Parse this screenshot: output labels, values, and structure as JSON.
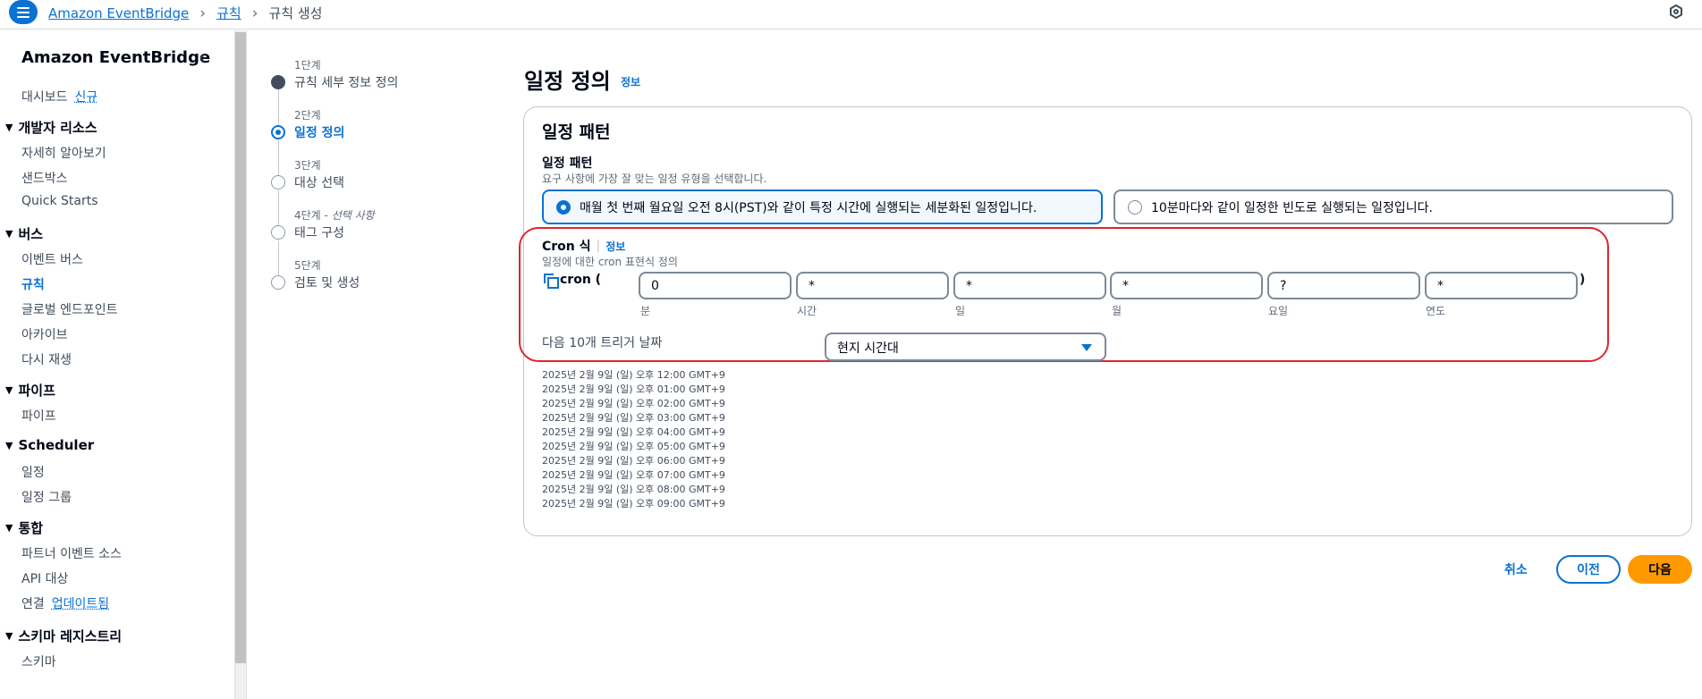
{
  "header": {
    "breadcrumbs": [
      "Amazon EventBridge",
      "규칙",
      "규칙 생성"
    ],
    "menu_icon": "hamburger-menu-icon",
    "settings_icon": "hexagon-gear-icon"
  },
  "sidebar": {
    "title": "Amazon EventBridge",
    "close_icon": "chevron-left-icon",
    "dashboard": {
      "label": "대시보드",
      "badge": "신규"
    },
    "sections": [
      {
        "title": "개발자 리소스",
        "items": [
          "자세히 알아보기",
          "샌드박스",
          "Quick Starts"
        ]
      },
      {
        "title": "버스",
        "items": [
          "이벤트 버스",
          "규칙",
          "글로벌 엔드포인트",
          "아카이브",
          "다시 재생"
        ]
      },
      {
        "title": "파이프",
        "items": [
          "파이프"
        ]
      },
      {
        "title": "Scheduler",
        "items": [
          "일정",
          "일정 그룹"
        ]
      },
      {
        "title": "통합",
        "items": [
          "파트너 이벤트 소스",
          "API 대상"
        ]
      },
      {
        "title": "스키마 레지스트리",
        "items": [
          "스키마"
        ]
      }
    ],
    "connection": {
      "label": "연결",
      "badge": "업데이트됨"
    },
    "active_item": "규칙"
  },
  "steps": [
    {
      "num": "1단계",
      "label": "규칙 세부 정보 정의",
      "state": "done"
    },
    {
      "num": "2단계",
      "label": "일정 정의",
      "state": "current"
    },
    {
      "num": "3단계",
      "label": "대상 선택",
      "state": "todo"
    },
    {
      "num": "4단계",
      "optional": "선택 사항",
      "label": "태그 구성",
      "state": "todo"
    },
    {
      "num": "5단계",
      "label": "검토 및 생성",
      "state": "todo"
    }
  ],
  "main": {
    "title": "일정 정의",
    "info": "정보",
    "card_title": "일정 패턴",
    "pattern_label": "일정 패턴",
    "pattern_desc": "요구 사항에 가장 잘 맞는 일정 유형을 선택합니다.",
    "options": [
      {
        "label": "매월 첫 번째 월요일 오전 8시(PST)와 같이 특정 시간에 실행되는 세분화된 일정입니다.",
        "selected": true
      },
      {
        "label": "10분마다와 같이 일정한 빈도로 실행되는 일정입니다.",
        "selected": false
      }
    ],
    "cron": {
      "label": "Cron 식",
      "info": "정보",
      "desc": "일정에 대한 cron 표현식 정의",
      "prefix": "cron (",
      "suffix": ")",
      "fields": [
        {
          "value": "0",
          "sub": "분"
        },
        {
          "value": "*",
          "sub": "시간"
        },
        {
          "value": "*",
          "sub": "일"
        },
        {
          "value": "*",
          "sub": "월"
        },
        {
          "value": "?",
          "sub": "요일"
        },
        {
          "value": "*",
          "sub": "연도"
        }
      ]
    },
    "next_trigger_label": "다음 10개 트리거 날짜",
    "timezone": "현지 시간대",
    "trigger_dates": [
      "2025년 2월 9일 (일) 오후 12:00 GMT+9",
      "2025년 2월 9일 (일) 오후 01:00 GMT+9",
      "2025년 2월 9일 (일) 오후 02:00 GMT+9",
      "2025년 2월 9일 (일) 오후 03:00 GMT+9",
      "2025년 2월 9일 (일) 오후 04:00 GMT+9",
      "2025년 2월 9일 (일) 오후 05:00 GMT+9",
      "2025년 2월 9일 (일) 오후 06:00 GMT+9",
      "2025년 2월 9일 (일) 오후 07:00 GMT+9",
      "2025년 2월 9일 (일) 오후 08:00 GMT+9",
      "2025년 2월 9일 (일) 오후 09:00 GMT+9"
    ]
  },
  "footer": {
    "cancel": "취소",
    "previous": "이전",
    "next": "다음"
  },
  "colors": {
    "accent": "#0972d3",
    "primary_button": "#ff9900",
    "highlight_border": "#e0242c"
  }
}
